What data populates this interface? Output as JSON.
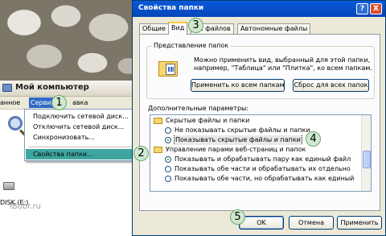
{
  "explorer": {
    "title": "Мой компьютер",
    "menu": {
      "prev_item": "анное",
      "service": "Сервис",
      "next_item": "авка"
    },
    "drive_label": "DISK (E:)"
  },
  "service_menu": {
    "items": [
      "Подключить сетевой диск...",
      "Отключить сетевой диск...",
      "Синхронизовать...",
      "Свойства папки..."
    ]
  },
  "dialog": {
    "title": "Свойства папки",
    "help_label": "?",
    "close_label": "X",
    "tabs": [
      "Общие",
      "Вид",
      "пы файлов",
      "Автономные файлы"
    ],
    "view_group": {
      "label": "Представление папок",
      "description": "Можно применить вид, выбранный для этой папки, например, \"Таблица\" или \"Плитка\", ко всем папкам.",
      "apply_all_button": "Применить ко всем папкам",
      "reset_all_button": "Сброс для всех папок"
    },
    "advanced_label": "Дополнительные параметры:",
    "advanced_items": [
      {
        "text": "Скрытые файлы и папки",
        "kind": "category"
      },
      {
        "text": "Не показывать скрытые файлы и папки",
        "kind": "radio",
        "checked": false
      },
      {
        "text": "Показывать скрытые файлы и папки",
        "kind": "radio",
        "checked": true
      },
      {
        "text": "Управление парами веб-страниц и папок",
        "kind": "category"
      },
      {
        "text": "Показывать и обрабатывать пару как единый файл",
        "kind": "radio",
        "checked": true
      },
      {
        "text": "Показывать обе части и обрабатывать их отдельно",
        "kind": "radio",
        "checked": false
      },
      {
        "text": "Показывать обе части, но обрабатывать как единый",
        "kind": "radio",
        "checked": false
      }
    ],
    "buttons": {
      "ok": "OK",
      "cancel": "Отмена",
      "apply": "Применить"
    }
  },
  "callouts": [
    "1",
    "2",
    "3",
    "4",
    "5"
  ],
  "watermark": "iBobr.ru",
  "colors": {
    "titlebar": "#0a5ad8",
    "menu_highlight": "#316ac5",
    "dropdown_highlight": "#3ea5a0",
    "callout_fill": "#cfe8cf"
  }
}
